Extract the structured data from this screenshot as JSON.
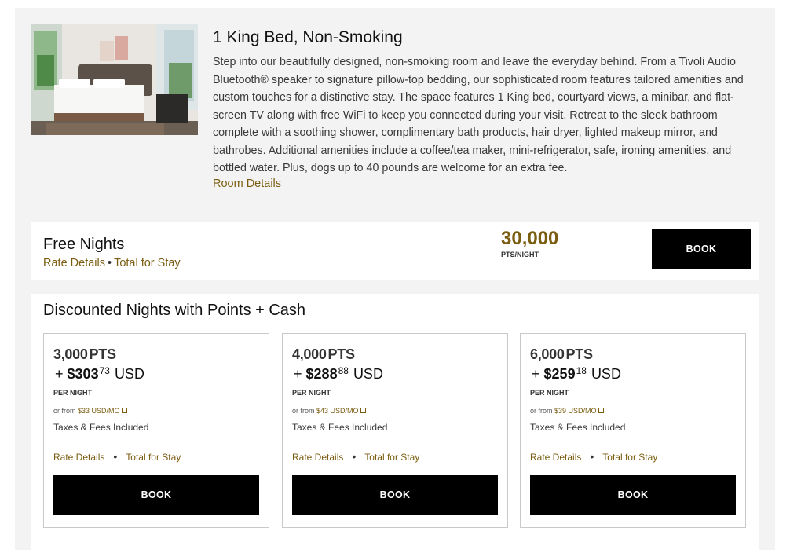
{
  "room": {
    "title": "1 King Bed, Non-Smoking",
    "description": "Step into our beautifully designed, non-smoking room and leave the everyday behind. From a Tivoli Audio Bluetooth® speaker to signature pillow-top bedding, our sophisticated room features tailored amenities and custom touches for a distinctive stay. The space features 1 King bed, courtyard views, a minibar, and flat-screen TV along with free WiFi to keep you connected during your visit. Retreat to the sleek bathroom complete with a soothing shower, complimentary bath products, hair dryer, lighted makeup mirror, and bathrobes. Additional amenities include a coffee/tea maker, mini-refrigerator, safe, ironing amenities, and bottled water. Plus, dogs up to 40 pounds are welcome for an extra fee.",
    "details_link": "Room Details"
  },
  "free_nights": {
    "title": "Free Nights",
    "rate_details": "Rate Details",
    "separator": "•",
    "total_for_stay": "Total for Stay",
    "points": "30,000",
    "points_unit": "PTS/NIGHT",
    "book_label": "BOOK"
  },
  "discounted": {
    "title": "Discounted Nights with Points + Cash",
    "options": [
      {
        "points": "3,000",
        "points_unit": "PTS",
        "plus": "+",
        "cash_dollars": "$303",
        "cash_cents": "73",
        "currency": "USD",
        "per_night": "PER NIGHT",
        "from_prefix": "or from",
        "monthly": "$33 USD/MO",
        "taxes": "Taxes & Fees Included",
        "rate_details": "Rate Details",
        "separator": "•",
        "total_for_stay": "Total for Stay",
        "book_label": "BOOK"
      },
      {
        "points": "4,000",
        "points_unit": "PTS",
        "plus": "+",
        "cash_dollars": "$288",
        "cash_cents": "88",
        "currency": "USD",
        "per_night": "PER NIGHT",
        "from_prefix": "or from",
        "monthly": "$43 USD/MO",
        "taxes": "Taxes & Fees Included",
        "rate_details": "Rate Details",
        "separator": "•",
        "total_for_stay": "Total for Stay",
        "book_label": "BOOK"
      },
      {
        "points": "6,000",
        "points_unit": "PTS",
        "plus": "+",
        "cash_dollars": "$259",
        "cash_cents": "18",
        "currency": "USD",
        "per_night": "PER NIGHT",
        "from_prefix": "or from",
        "monthly": "$39 USD/MO",
        "taxes": "Taxes & Fees Included",
        "rate_details": "Rate Details",
        "separator": "•",
        "total_for_stay": "Total for Stay",
        "book_label": "BOOK"
      }
    ]
  },
  "colors": {
    "accent_gold": "#7a5d10",
    "button_bg": "#000000",
    "panel_bg": "#f3f3f3"
  }
}
